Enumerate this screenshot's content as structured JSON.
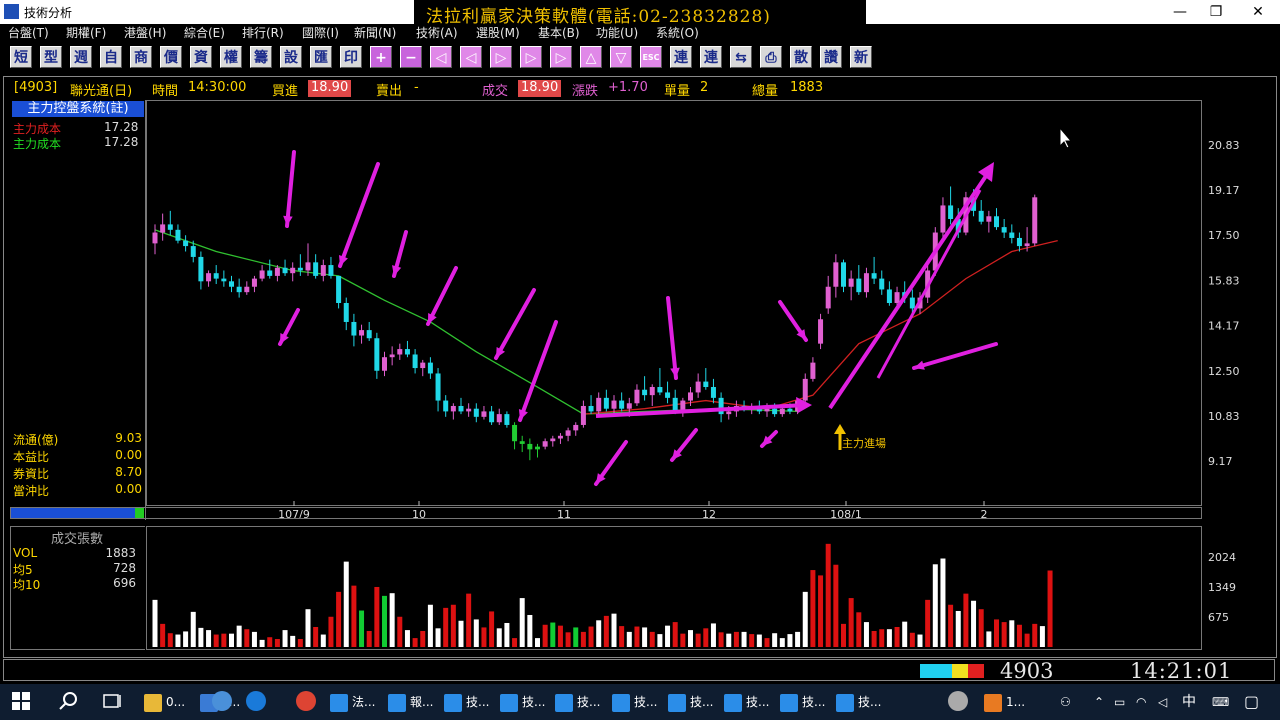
{
  "window": {
    "title": "技術分析",
    "banner": "法拉利贏家決策軟體(電話:02-23832828)",
    "minimize": "—",
    "maximize": "❐",
    "close": "✕"
  },
  "menu": [
    "台盤(T)",
    "期權(F)",
    "港盤(H)",
    "綜合(E)",
    "排行(R)",
    "國際(I)",
    "新聞(N)",
    "技術(A)",
    "選股(M)",
    "基本(B)",
    "功能(U)",
    "系統(O)"
  ],
  "toolbar": [
    "短",
    "型",
    "週",
    "自",
    "商",
    "價",
    "資",
    "權",
    "籌",
    "設",
    "匯",
    "印",
    "+",
    "−",
    "◁",
    "◁",
    "▷",
    "▷",
    "▷",
    "△",
    "▽",
    "ESC",
    "連",
    "連",
    "⇆",
    "⎙",
    "散",
    "讚",
    "新"
  ],
  "quote": {
    "code": "[4903]",
    "name": "聯光通(日)",
    "time_label": "時間",
    "time": "14:30:00",
    "bid_label": "買進",
    "bid": "18.90",
    "ask_label": "賣出",
    "ask": "-",
    "last_label": "成交",
    "last": "18.90",
    "change_label": "漲跌",
    "change": "+1.70",
    "single_label": "單量",
    "single": "2",
    "total_label": "總量",
    "total": "1883"
  },
  "indicator": {
    "title": "主力控盤系統(註)",
    "lines": [
      {
        "label": "主力成本",
        "value": "17.28",
        "color": "#e02020"
      },
      {
        "label": "主力成本",
        "value": "17.28",
        "color": "#22dd22"
      }
    ]
  },
  "stats": [
    {
      "label": "流通(億)",
      "value": "9.03"
    },
    {
      "label": "本益比",
      "value": "0.00"
    },
    {
      "label": "券資比",
      "value": "8.70"
    },
    {
      "label": "當沖比",
      "value": "0.00"
    }
  ],
  "price_axis": [
    "20.83",
    "19.17",
    "17.50",
    "15.83",
    "14.17",
    "12.50",
    "10.83",
    "9.17"
  ],
  "date_axis": [
    "107/9",
    "10",
    "11",
    "12",
    "108/1",
    "2"
  ],
  "annotation": "主力進場",
  "volume_panel": {
    "title": "成交張數",
    "lines": [
      {
        "label": "VOL",
        "value": "1883"
      },
      {
        "label": "均5",
        "value": "728"
      },
      {
        "label": "均10",
        "value": "696"
      }
    ],
    "axis": [
      "2024",
      "1349",
      "675"
    ]
  },
  "status": {
    "code": "4903",
    "clock": "14:21:01"
  },
  "taskbar": {
    "items": [
      "0...",
      "L...",
      "法...",
      "報...",
      "技...",
      "技...",
      "技...",
      "技...",
      "技...",
      "技...",
      "技...",
      "技...",
      "1..."
    ],
    "ime": "中"
  },
  "colors": {
    "up": "#e060d0",
    "down": "#20d8e8",
    "ma_green": "#30c030",
    "ma_red": "#d02020",
    "arrow": "#e020e0",
    "vol_red": "#dd1111",
    "vol_white": "#ffffff",
    "vol_green": "#11cc33"
  },
  "chart_data": {
    "type": "candlestick",
    "price_ticks": [
      20.83,
      19.17,
      17.5,
      15.83,
      14.17,
      12.5,
      10.83,
      9.17
    ],
    "ylim": [
      8.0,
      22.5
    ],
    "candles": [
      [
        17.2,
        17.9,
        16.8,
        17.6
      ],
      [
        17.6,
        18.3,
        17.3,
        17.9
      ],
      [
        17.9,
        18.4,
        17.5,
        17.7
      ],
      [
        17.7,
        17.9,
        17.2,
        17.3
      ],
      [
        17.3,
        17.5,
        16.9,
        17.1
      ],
      [
        17.1,
        17.3,
        16.5,
        16.7
      ],
      [
        16.7,
        16.9,
        15.5,
        15.8
      ],
      [
        15.8,
        16.2,
        15.6,
        16.1
      ],
      [
        16.1,
        16.4,
        15.7,
        15.9
      ],
      [
        15.9,
        16.2,
        15.6,
        15.8
      ],
      [
        15.8,
        16.0,
        15.4,
        15.6
      ],
      [
        15.6,
        15.9,
        15.2,
        15.4
      ],
      [
        15.4,
        15.8,
        15.3,
        15.6
      ],
      [
        15.6,
        16.0,
        15.4,
        15.9
      ],
      [
        15.9,
        16.4,
        15.8,
        16.2
      ],
      [
        16.2,
        16.6,
        15.9,
        16.0
      ],
      [
        16.0,
        16.4,
        15.8,
        16.3
      ],
      [
        16.3,
        16.6,
        16.0,
        16.1
      ],
      [
        16.1,
        16.5,
        15.8,
        16.3
      ],
      [
        16.3,
        16.8,
        16.0,
        16.2
      ],
      [
        16.2,
        17.2,
        16.0,
        16.5
      ],
      [
        16.5,
        16.8,
        15.9,
        16.0
      ],
      [
        16.0,
        16.6,
        15.8,
        16.4
      ],
      [
        16.4,
        16.7,
        15.9,
        16.0
      ],
      [
        16.0,
        15.7,
        14.8,
        15.0
      ],
      [
        15.0,
        15.2,
        14.0,
        14.3
      ],
      [
        14.3,
        14.6,
        13.4,
        13.8
      ],
      [
        13.8,
        14.2,
        13.5,
        14.0
      ],
      [
        14.0,
        14.3,
        13.6,
        13.7
      ],
      [
        13.7,
        13.9,
        12.2,
        12.5
      ],
      [
        12.5,
        13.2,
        12.3,
        13.0
      ],
      [
        13.0,
        13.4,
        12.7,
        13.1
      ],
      [
        13.1,
        13.5,
        12.9,
        13.3
      ],
      [
        13.3,
        13.6,
        13.0,
        13.1
      ],
      [
        13.1,
        13.3,
        12.4,
        12.6
      ],
      [
        12.6,
        12.9,
        12.3,
        12.8
      ],
      [
        12.8,
        13.0,
        12.2,
        12.4
      ],
      [
        12.4,
        12.6,
        11.0,
        11.4
      ],
      [
        11.4,
        11.6,
        10.8,
        11.0
      ],
      [
        11.0,
        11.3,
        10.7,
        11.2
      ],
      [
        11.2,
        11.5,
        10.9,
        11.0
      ],
      [
        11.0,
        11.3,
        10.8,
        11.1
      ],
      [
        11.1,
        11.3,
        10.6,
        10.8
      ],
      [
        10.8,
        11.2,
        10.7,
        11.0
      ],
      [
        11.0,
        11.2,
        10.5,
        10.6
      ],
      [
        10.6,
        11.1,
        10.5,
        10.9
      ],
      [
        10.9,
        11.0,
        10.4,
        10.5
      ],
      [
        10.5,
        10.6,
        9.6,
        9.9
      ],
      [
        9.9,
        10.1,
        9.5,
        9.8
      ],
      [
        9.8,
        10.0,
        9.2,
        9.6
      ],
      [
        9.6,
        9.8,
        9.3,
        9.7
      ],
      [
        9.7,
        10.0,
        9.6,
        9.9
      ],
      [
        9.9,
        10.1,
        9.7,
        10.0
      ],
      [
        10.0,
        10.2,
        9.8,
        10.1
      ],
      [
        10.1,
        10.4,
        9.9,
        10.3
      ],
      [
        10.3,
        10.6,
        10.1,
        10.5
      ],
      [
        10.5,
        11.4,
        10.4,
        11.2
      ],
      [
        11.2,
        11.6,
        10.9,
        11.0
      ],
      [
        11.0,
        11.7,
        10.8,
        11.5
      ],
      [
        11.5,
        11.8,
        11.0,
        11.1
      ],
      [
        11.1,
        11.6,
        10.9,
        11.4
      ],
      [
        11.4,
        11.7,
        11.0,
        11.1
      ],
      [
        11.1,
        11.5,
        10.8,
        11.3
      ],
      [
        11.3,
        12.0,
        11.2,
        11.8
      ],
      [
        11.8,
        12.3,
        11.4,
        11.6
      ],
      [
        11.6,
        12.0,
        11.2,
        11.9
      ],
      [
        11.9,
        12.6,
        11.6,
        11.7
      ],
      [
        11.7,
        12.1,
        11.3,
        11.5
      ],
      [
        11.5,
        11.8,
        10.9,
        11.0
      ],
      [
        11.0,
        11.5,
        10.8,
        11.4
      ],
      [
        11.4,
        11.9,
        11.2,
        11.7
      ],
      [
        11.7,
        12.4,
        11.5,
        12.1
      ],
      [
        12.1,
        12.6,
        11.8,
        11.9
      ],
      [
        11.9,
        12.2,
        11.3,
        11.5
      ],
      [
        11.5,
        11.7,
        10.6,
        10.9
      ],
      [
        10.9,
        11.2,
        10.7,
        11.0
      ],
      [
        11.0,
        11.4,
        10.8,
        11.2
      ],
      [
        11.2,
        11.4,
        11.0,
        11.1
      ],
      [
        11.1,
        11.3,
        10.9,
        11.2
      ],
      [
        11.2,
        11.4,
        10.9,
        11.0
      ],
      [
        11.0,
        11.3,
        10.8,
        11.1
      ],
      [
        11.1,
        11.3,
        10.8,
        10.9
      ],
      [
        10.9,
        11.2,
        10.8,
        11.1
      ],
      [
        11.1,
        11.3,
        10.9,
        11.0
      ],
      [
        11.0,
        11.5,
        10.9,
        11.4
      ],
      [
        11.4,
        12.4,
        11.2,
        12.2
      ],
      [
        12.2,
        13.0,
        12.1,
        12.8
      ],
      [
        13.5,
        14.6,
        13.3,
        14.4
      ],
      [
        14.8,
        16.0,
        14.6,
        15.6
      ],
      [
        15.6,
        16.8,
        15.2,
        16.5
      ],
      [
        16.5,
        16.6,
        15.4,
        15.6
      ],
      [
        15.6,
        16.2,
        15.1,
        15.9
      ],
      [
        15.9,
        16.4,
        15.3,
        15.4
      ],
      [
        15.4,
        16.3,
        15.2,
        16.1
      ],
      [
        16.1,
        16.7,
        15.7,
        15.9
      ],
      [
        15.9,
        16.2,
        15.3,
        15.5
      ],
      [
        15.5,
        15.8,
        14.9,
        15.0
      ],
      [
        15.0,
        15.6,
        14.7,
        15.4
      ],
      [
        15.4,
        15.8,
        15.0,
        15.2
      ],
      [
        15.2,
        15.5,
        14.6,
        14.8
      ],
      [
        14.8,
        15.4,
        14.6,
        15.2
      ],
      [
        15.2,
        16.4,
        15.0,
        16.2
      ],
      [
        16.2,
        17.8,
        16.0,
        17.6
      ],
      [
        17.6,
        18.9,
        17.4,
        18.6
      ],
      [
        18.6,
        19.3,
        17.9,
        18.1
      ],
      [
        18.1,
        18.5,
        17.4,
        17.6
      ],
      [
        17.6,
        19.1,
        17.5,
        18.9
      ],
      [
        18.9,
        19.2,
        18.2,
        18.4
      ],
      [
        18.4,
        18.8,
        17.9,
        18.0
      ],
      [
        18.0,
        18.4,
        17.6,
        18.2
      ],
      [
        18.2,
        18.5,
        17.7,
        17.8
      ],
      [
        17.8,
        18.1,
        17.4,
        17.6
      ],
      [
        17.6,
        17.9,
        17.2,
        17.4
      ],
      [
        17.4,
        17.6,
        16.9,
        17.1
      ],
      [
        17.1,
        17.8,
        16.9,
        17.2
      ],
      [
        17.2,
        19.0,
        17.1,
        18.9
      ]
    ],
    "volumes": [
      1060,
      520,
      310,
      280,
      350,
      790,
      430,
      380,
      280,
      300,
      300,
      480,
      400,
      340,
      160,
      220,
      180,
      380,
      250,
      180,
      850,
      450,
      280,
      680,
      1240,
      1920,
      1380,
      820,
      360,
      1350,
      1150,
      1210,
      680,
      380,
      200,
      360,
      950,
      420,
      880,
      950,
      590,
      1200,
      620,
      440,
      800,
      420,
      540,
      200,
      1100,
      720,
      200,
      500,
      550,
      480,
      330,
      440,
      340,
      460,
      600,
      700,
      750,
      470,
      340,
      460,
      440,
      340,
      290,
      480,
      560,
      300,
      380,
      300,
      420,
      530,
      330,
      300,
      340,
      340,
      290,
      280,
      200,
      310,
      200,
      290,
      340,
      1240,
      1730,
      1610,
      2320,
      1850,
      520,
      1100,
      780,
      560,
      360,
      400,
      400,
      450,
      570,
      320,
      280,
      1060,
      1860,
      1990,
      950,
      810,
      1200,
      1040,
      850,
      350,
      620,
      560,
      600,
      500,
      300,
      520,
      470,
      1720
    ],
    "vol_colors": "wrrwwwwwrrwwrwwrrwwrwrwrrwrgrrgwrwrrwwrrwrwrrwwrwwwrgrrgrrwrwrwrwrwwrrwrrwrwrwrwrwwwwwrrrrrrrwrrwrwrwrwwrwrwrwrrwrrrwrrwwrwrr",
    "ma_green": [
      [
        0,
        17.7
      ],
      [
        8,
        16.9
      ],
      [
        18,
        16.2
      ],
      [
        24,
        16.0
      ],
      [
        30,
        15.1
      ],
      [
        36,
        14.3
      ],
      [
        42,
        13.2
      ],
      [
        50,
        11.9
      ],
      [
        56,
        10.9
      ],
      [
        64,
        11.0
      ],
      [
        74,
        11.1
      ],
      [
        84,
        11.0
      ]
    ],
    "ma_red": [
      [
        56,
        10.9
      ],
      [
        64,
        11.1
      ],
      [
        72,
        11.4
      ],
      [
        80,
        11.1
      ],
      [
        86,
        11.6
      ],
      [
        92,
        13.5
      ],
      [
        100,
        14.6
      ],
      [
        106,
        15.9
      ],
      [
        112,
        16.9
      ],
      [
        118,
        17.3
      ]
    ]
  }
}
